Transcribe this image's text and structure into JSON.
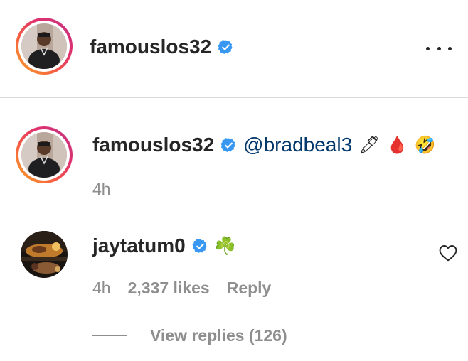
{
  "header": {
    "username": "famouslos32",
    "more_icon": "more-horizontal-icon"
  },
  "caption": {
    "username": "famouslos32",
    "mention": "@bradbeal3",
    "emojis": [
      "🖊",
      "🩸",
      "🤣"
    ],
    "time": "4h"
  },
  "comment": {
    "username": "jaytatum0",
    "emoji": "☘️",
    "time": "4h",
    "likes": "2,337 likes",
    "reply_label": "Reply",
    "view_replies": "View replies (126)"
  },
  "colors": {
    "verified_blue": "#3897f0",
    "mention_blue": "#00376b",
    "meta_gray": "#8e8e8e",
    "divider": "#dbdbdb"
  }
}
